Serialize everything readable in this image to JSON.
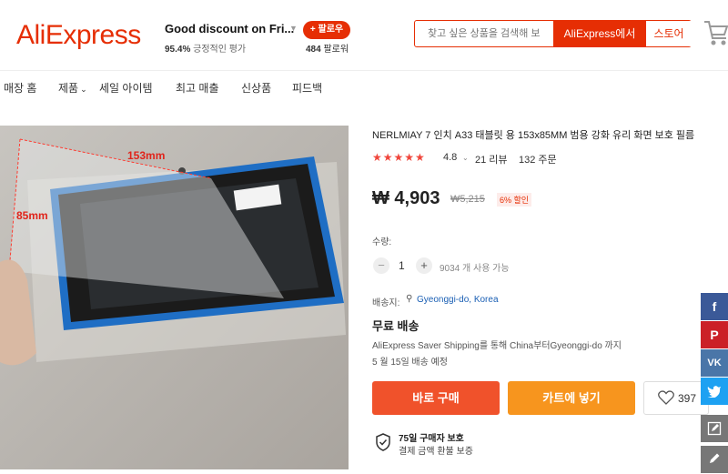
{
  "header": {
    "logo": "AliExpress",
    "store_name": "Good discount on Fri...",
    "rating_value": "95.4%",
    "rating_label": "긍정적인 평가",
    "follow_label": "+ 팔로우",
    "followers_count": "484",
    "followers_label": "팔로워",
    "search_placeholder": "찾고 싶은 상품을 검색해 보",
    "search_aliexpress_label": "AliExpress에서",
    "search_store_label": "스토어"
  },
  "nav": {
    "items": [
      "매장 홈",
      "제품",
      "세일 아이템",
      "최고 매출",
      "신상품",
      "피드백"
    ]
  },
  "product_image": {
    "annotation_width": "153mm",
    "annotation_height": "85mm"
  },
  "product": {
    "title": "NERLMIAY 7 인치 A33 태블릿 용 153x85MM 범용 강화 유리 화면 보호 필름",
    "stars": "★★★★★",
    "rating": "4.8",
    "reviews": "21 리뷰",
    "orders": "132 주문",
    "price": "₩ 4,903",
    "old_price": "₩5,215",
    "discount": "6% 할인",
    "quantity_label": "수량:",
    "quantity_value": "1",
    "quantity_available": "9034 개 사용 가능",
    "ship_to_label": "배송지:",
    "ship_to_value": "Gyeonggi-do, Korea",
    "free_shipping": "무료 배송",
    "shipping_method": "AliExpress Saver Shipping를 통해 China부터Gyeonggi-do 까지",
    "delivery_date": "5 월 15일 배송 예정",
    "buy_label": "바로 구매",
    "cart_label": "카트에 넣기",
    "wishlist_count": "397",
    "guarantee_title": "75일 구매자 보호",
    "guarantee_sub": "결제 금액 환불 보증"
  },
  "colors": {
    "brand": "#e62e04",
    "buy": "#f0522b",
    "cart": "#f7951e",
    "facebook": "#3b5998",
    "pinterest": "#cb2027",
    "vk": "#4a76a8",
    "twitter": "#1da1f2",
    "edit": "#777777"
  },
  "social_icons": [
    "facebook-icon",
    "pinterest-icon",
    "vk-icon",
    "twitter-icon",
    "edit-icon",
    "pencil-icon"
  ]
}
